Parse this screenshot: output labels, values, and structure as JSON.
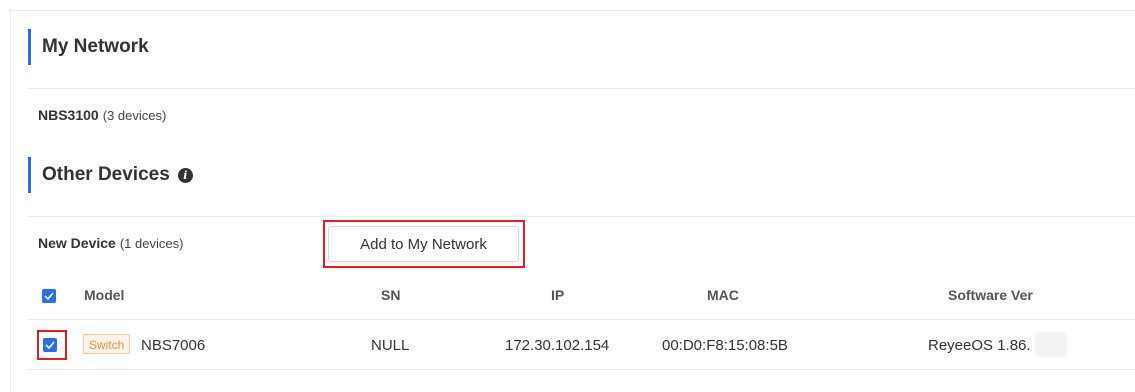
{
  "my_network": {
    "title": "My Network",
    "group": {
      "name": "NBS3100",
      "count": "(3 devices)"
    }
  },
  "other_devices": {
    "title": "Other Devices",
    "info_icon": "info-icon",
    "group": {
      "name": "New Device",
      "count": "(1 devices)"
    },
    "add_button_label": "Add to My Network"
  },
  "table": {
    "columns": [
      "Model",
      "SN",
      "IP",
      "MAC",
      "Software Ver"
    ],
    "header_checked": true,
    "rows": [
      {
        "checked": true,
        "type_badge": "Switch",
        "model": "NBS7006",
        "sn": "NULL",
        "ip": "172.30.102.154",
        "mac": "00:D0:F8:15:08:5B",
        "software_ver": "ReyeeOS 1.86."
      }
    ]
  },
  "colors": {
    "accent": "#2b6fe8",
    "highlight": "#e02020",
    "badge_text": "#f08a3c",
    "badge_bg": "#fff4ec"
  }
}
